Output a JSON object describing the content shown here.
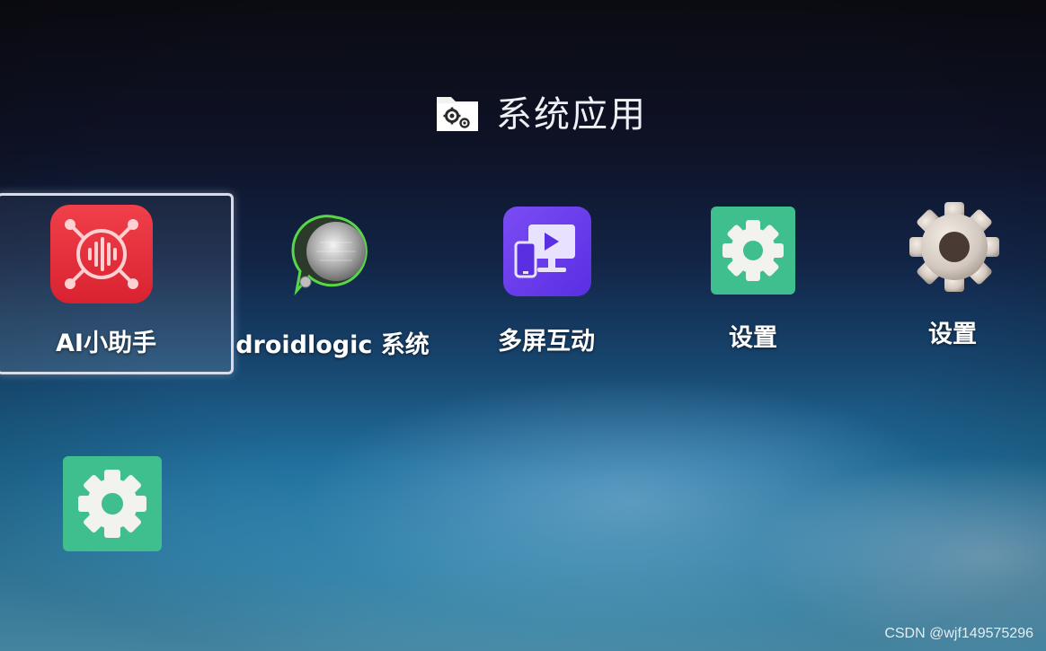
{
  "folder": {
    "title": "系统应用",
    "icon": "folder-settings-icon"
  },
  "apps": [
    {
      "label": "AI小助手",
      "icon": "ai-assistant-icon",
      "focused": true
    },
    {
      "label": "droidlogic 系统",
      "icon": "droidlogic-knob-icon",
      "focused": false
    },
    {
      "label": "多屏互动",
      "icon": "multiscreen-cast-icon",
      "focused": false
    },
    {
      "label": "设置",
      "icon": "green-gear-icon",
      "focused": false
    },
    {
      "label": "设置",
      "icon": "silver-gear-icon",
      "focused": false
    },
    {
      "label": "",
      "icon": "green-gear-icon",
      "focused": false
    }
  ],
  "watermark": "CSDN @wjf149575296",
  "colors": {
    "ai_red": "#e8333b",
    "cast_purple": "#6a3df0",
    "settings_green": "#3fbf8e",
    "focus_border": "#d9dce6"
  }
}
